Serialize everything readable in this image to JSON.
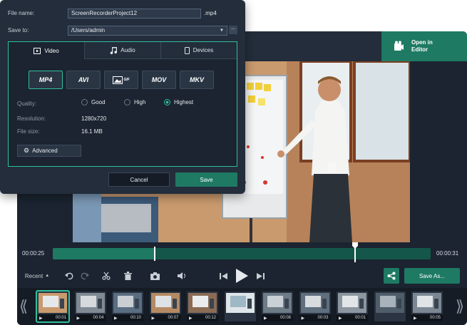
{
  "save_dialog": {
    "file_name_label": "File name:",
    "file_name_value": "ScreenRecorderProject12",
    "file_ext": ".mp4",
    "save_to_label": "Save to:",
    "save_to_value": "/Users/admin",
    "browse_label": "...",
    "tabs": [
      {
        "label": "Video",
        "icon": "video-icon",
        "active": true
      },
      {
        "label": "Audio",
        "icon": "music-icon",
        "active": false
      },
      {
        "label": "Devices",
        "icon": "phone-icon",
        "active": false
      }
    ],
    "formats": [
      {
        "label": "MP4",
        "active": true
      },
      {
        "label": "AVI",
        "active": false
      },
      {
        "label": "GIF",
        "active": false
      },
      {
        "label": "MOV",
        "active": false
      },
      {
        "label": "MKV",
        "active": false
      }
    ],
    "quality_label": "Quality:",
    "quality_options": [
      {
        "label": "Good",
        "selected": false
      },
      {
        "label": "High",
        "selected": false
      },
      {
        "label": "Highest",
        "selected": true
      }
    ],
    "resolution_label": "Resolution:",
    "resolution_value": "1280x720",
    "file_size_label": "File size:",
    "file_size_value": "16.1 MB",
    "advanced_label": "Advanced",
    "cancel_label": "Cancel",
    "save_label": "Save"
  },
  "editor": {
    "open_editor_label_1": "Open in",
    "open_editor_label_2": "Editor"
  },
  "timeline": {
    "current_time": "00:00:25",
    "end_time": "00:00:31",
    "played_fraction": 0.27,
    "playhead_fraction": 0.8
  },
  "toolbar": {
    "recent_label": "Recent",
    "save_as_label": "Save As..."
  },
  "filmstrip": {
    "thumbnails": [
      {
        "time": "00:01",
        "selected": true
      },
      {
        "time": "00:04",
        "selected": false
      },
      {
        "time": "00:10",
        "selected": false
      },
      {
        "time": "00:07",
        "selected": false
      },
      {
        "time": "00:12",
        "selected": false
      },
      {
        "time": "",
        "selected": false
      },
      {
        "time": "00:08",
        "selected": false
      },
      {
        "time": "00:03",
        "selected": false
      },
      {
        "time": "00:01",
        "selected": false
      },
      {
        "time": "",
        "selected": false
      },
      {
        "time": "00:05",
        "selected": false
      }
    ]
  },
  "colors": {
    "accent": "#1e7a63",
    "accent_bright": "#2fbf9b",
    "panel_bg": "#232d3b",
    "app_bg": "#1b2430"
  }
}
